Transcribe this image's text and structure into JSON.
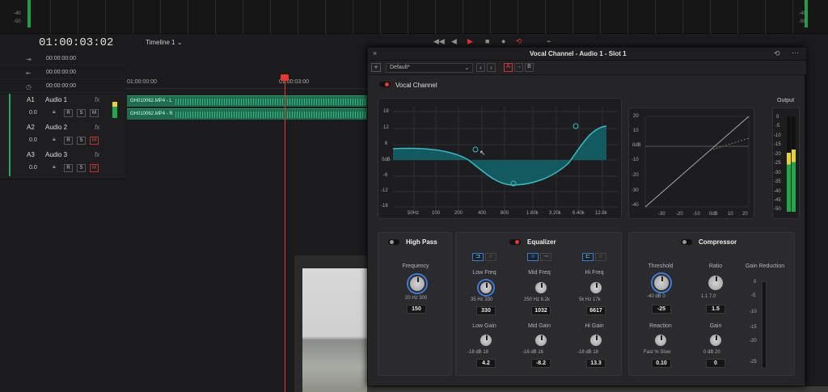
{
  "timeline": {
    "timecode": "01:00:03:02",
    "name": "Timeline 1",
    "rows": [
      {
        "icon": "⇥",
        "time": "00:00:00:00"
      },
      {
        "icon": "⇤",
        "time": "00:00:00:00"
      },
      {
        "icon": "◷",
        "time": "00:00:00:00"
      }
    ],
    "ruler": [
      "01:00:00:00",
      "01:00:03:00"
    ],
    "tracks": [
      {
        "id": "A1",
        "name": "Audio 1",
        "fx": "fx",
        "vol": "0.0"
      },
      {
        "id": "A2",
        "name": "Audio 2",
        "fx": "fx",
        "vol": "0.0"
      },
      {
        "id": "A3",
        "name": "Audio 3",
        "fx": "fx",
        "vol": "0.0"
      }
    ],
    "clips": [
      "GH010062.MP4 - L",
      "GH010062.MP4 - R"
    ],
    "btns": {
      "r": "R",
      "s": "S",
      "m": "M"
    }
  },
  "meter_labels": {
    "left": [
      "-40",
      "-50"
    ],
    "right": [
      "-40",
      "-50"
    ]
  },
  "panel": {
    "title": "Vocal Channel - Audio 1 -  Slot 1",
    "preset": "Default*",
    "ab": [
      "A",
      "→",
      "B"
    ],
    "vocal_channel_label": "Vocal Channel",
    "output_label": "Output",
    "eq_y_ticks": [
      "18",
      "12",
      "6",
      "0dB",
      "-6",
      "-12",
      "-18"
    ],
    "eq_x_ticks": [
      "50Hz",
      "100",
      "200",
      "400",
      "800",
      "1.60k",
      "3.20k",
      "6.40k",
      "12.8k"
    ],
    "comp_y_ticks": [
      "20",
      "10",
      "0dB",
      "-10",
      "-20",
      "-30",
      "-40"
    ],
    "comp_x_ticks": [
      "-30",
      "-20",
      "-10",
      "0dB",
      "10",
      "20"
    ],
    "out_ticks": [
      "0",
      "-5",
      "-10",
      "-15",
      "-20",
      "-25",
      "-30",
      "-35",
      "-40",
      "-45",
      "-50"
    ],
    "high_pass": {
      "title": "High Pass",
      "freq_label": "Frequency",
      "scale": "20  Hz  300",
      "value": "150"
    },
    "equalizer": {
      "title": "Equalizer",
      "bands": [
        {
          "freq_label": "Low Freq",
          "freq_scale": "35   Hz   330",
          "freq": "330",
          "gain_label": "Low Gain",
          "gain_scale": "-18   dB   18",
          "gain": "4.2"
        },
        {
          "freq_label": "Mid Freq",
          "freq_scale": "250  Hz  8.2k",
          "freq": "1032",
          "gain_label": "Mid Gain",
          "gain_scale": "-16   dB   16",
          "gain": "-8.2"
        },
        {
          "freq_label": "Hi Freq",
          "freq_scale": "5k   Hz   17k",
          "freq": "6617",
          "gain_label": "Hi Gain",
          "gain_scale": "-18   dB   18",
          "gain": "13.3"
        }
      ]
    },
    "compressor": {
      "title": "Compressor",
      "threshold_label": "Threshold",
      "threshold_scale": "-40  dB  0",
      "threshold": "-25",
      "ratio_label": "Ratio",
      "ratio_scale": "1.1       7.0",
      "ratio": "1.5",
      "gr_label": "Gain Reduction",
      "gr_ticks": [
        "0",
        "-5",
        "-10",
        "-15",
        "-20",
        "-25"
      ],
      "reaction_label": "Reaction",
      "reaction_scale": "Fast   %   Slow",
      "reaction": "0.10",
      "gain_label": "Gain",
      "gain_scale": "0   dB   20",
      "gain": "0"
    }
  }
}
